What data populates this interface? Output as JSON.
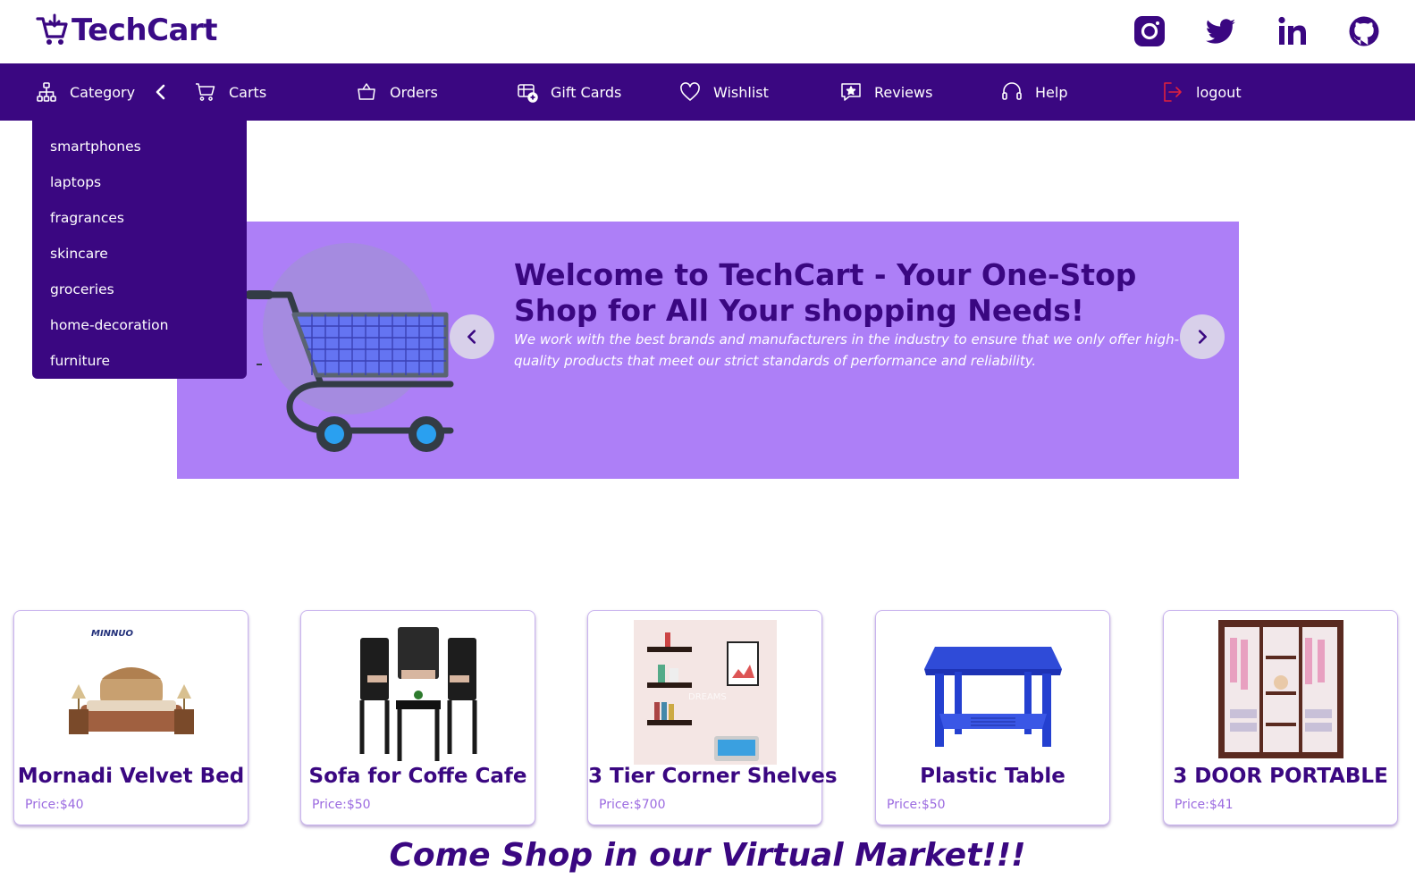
{
  "header": {
    "brand": "TechCart",
    "socials": [
      "instagram",
      "twitter",
      "linkedin",
      "github"
    ]
  },
  "nav": {
    "category": "Category",
    "items": [
      "Carts",
      "Orders",
      "Gift Cards",
      "Wishlist",
      "Reviews",
      "Help",
      "logout"
    ]
  },
  "categories": [
    "smartphones",
    "laptops",
    "fragrances",
    "skincare",
    "groceries",
    "home-decoration",
    "furniture"
  ],
  "hero": {
    "title": "Welcome to TechCart - Your One-Stop Shop for All Your shopping Needs!",
    "text": "We work with the best brands and manufacturers in the industry to ensure that we only offer high-quality products that meet our strict standards of performance and reliability."
  },
  "products": [
    {
      "name": "Mornadi Velvet Bed",
      "price": "Price:$40",
      "image": "bed"
    },
    {
      "name": "Sofa for Coffe Cafe",
      "price": "Price:$50",
      "image": "chairs"
    },
    {
      "name": "3 Tier Corner Shelves",
      "price": "Price:$700",
      "image": "shelves"
    },
    {
      "name": "Plastic Table",
      "price": "Price:$50",
      "image": "table"
    },
    {
      "name": "3 DOOR PORTABLE",
      "price": "Price:$41",
      "image": "wardrobe"
    }
  ],
  "product_image_labels": {
    "bed_logo": "MINNUO",
    "shelves_watermark": "DREAMS"
  },
  "tagline": "Come Shop in our Virtual Market!!!",
  "colors": {
    "primary": "#3a0781",
    "hero_bg": "#ad7ff7",
    "logout": "#e0203c",
    "price": "#9b6ae0"
  }
}
